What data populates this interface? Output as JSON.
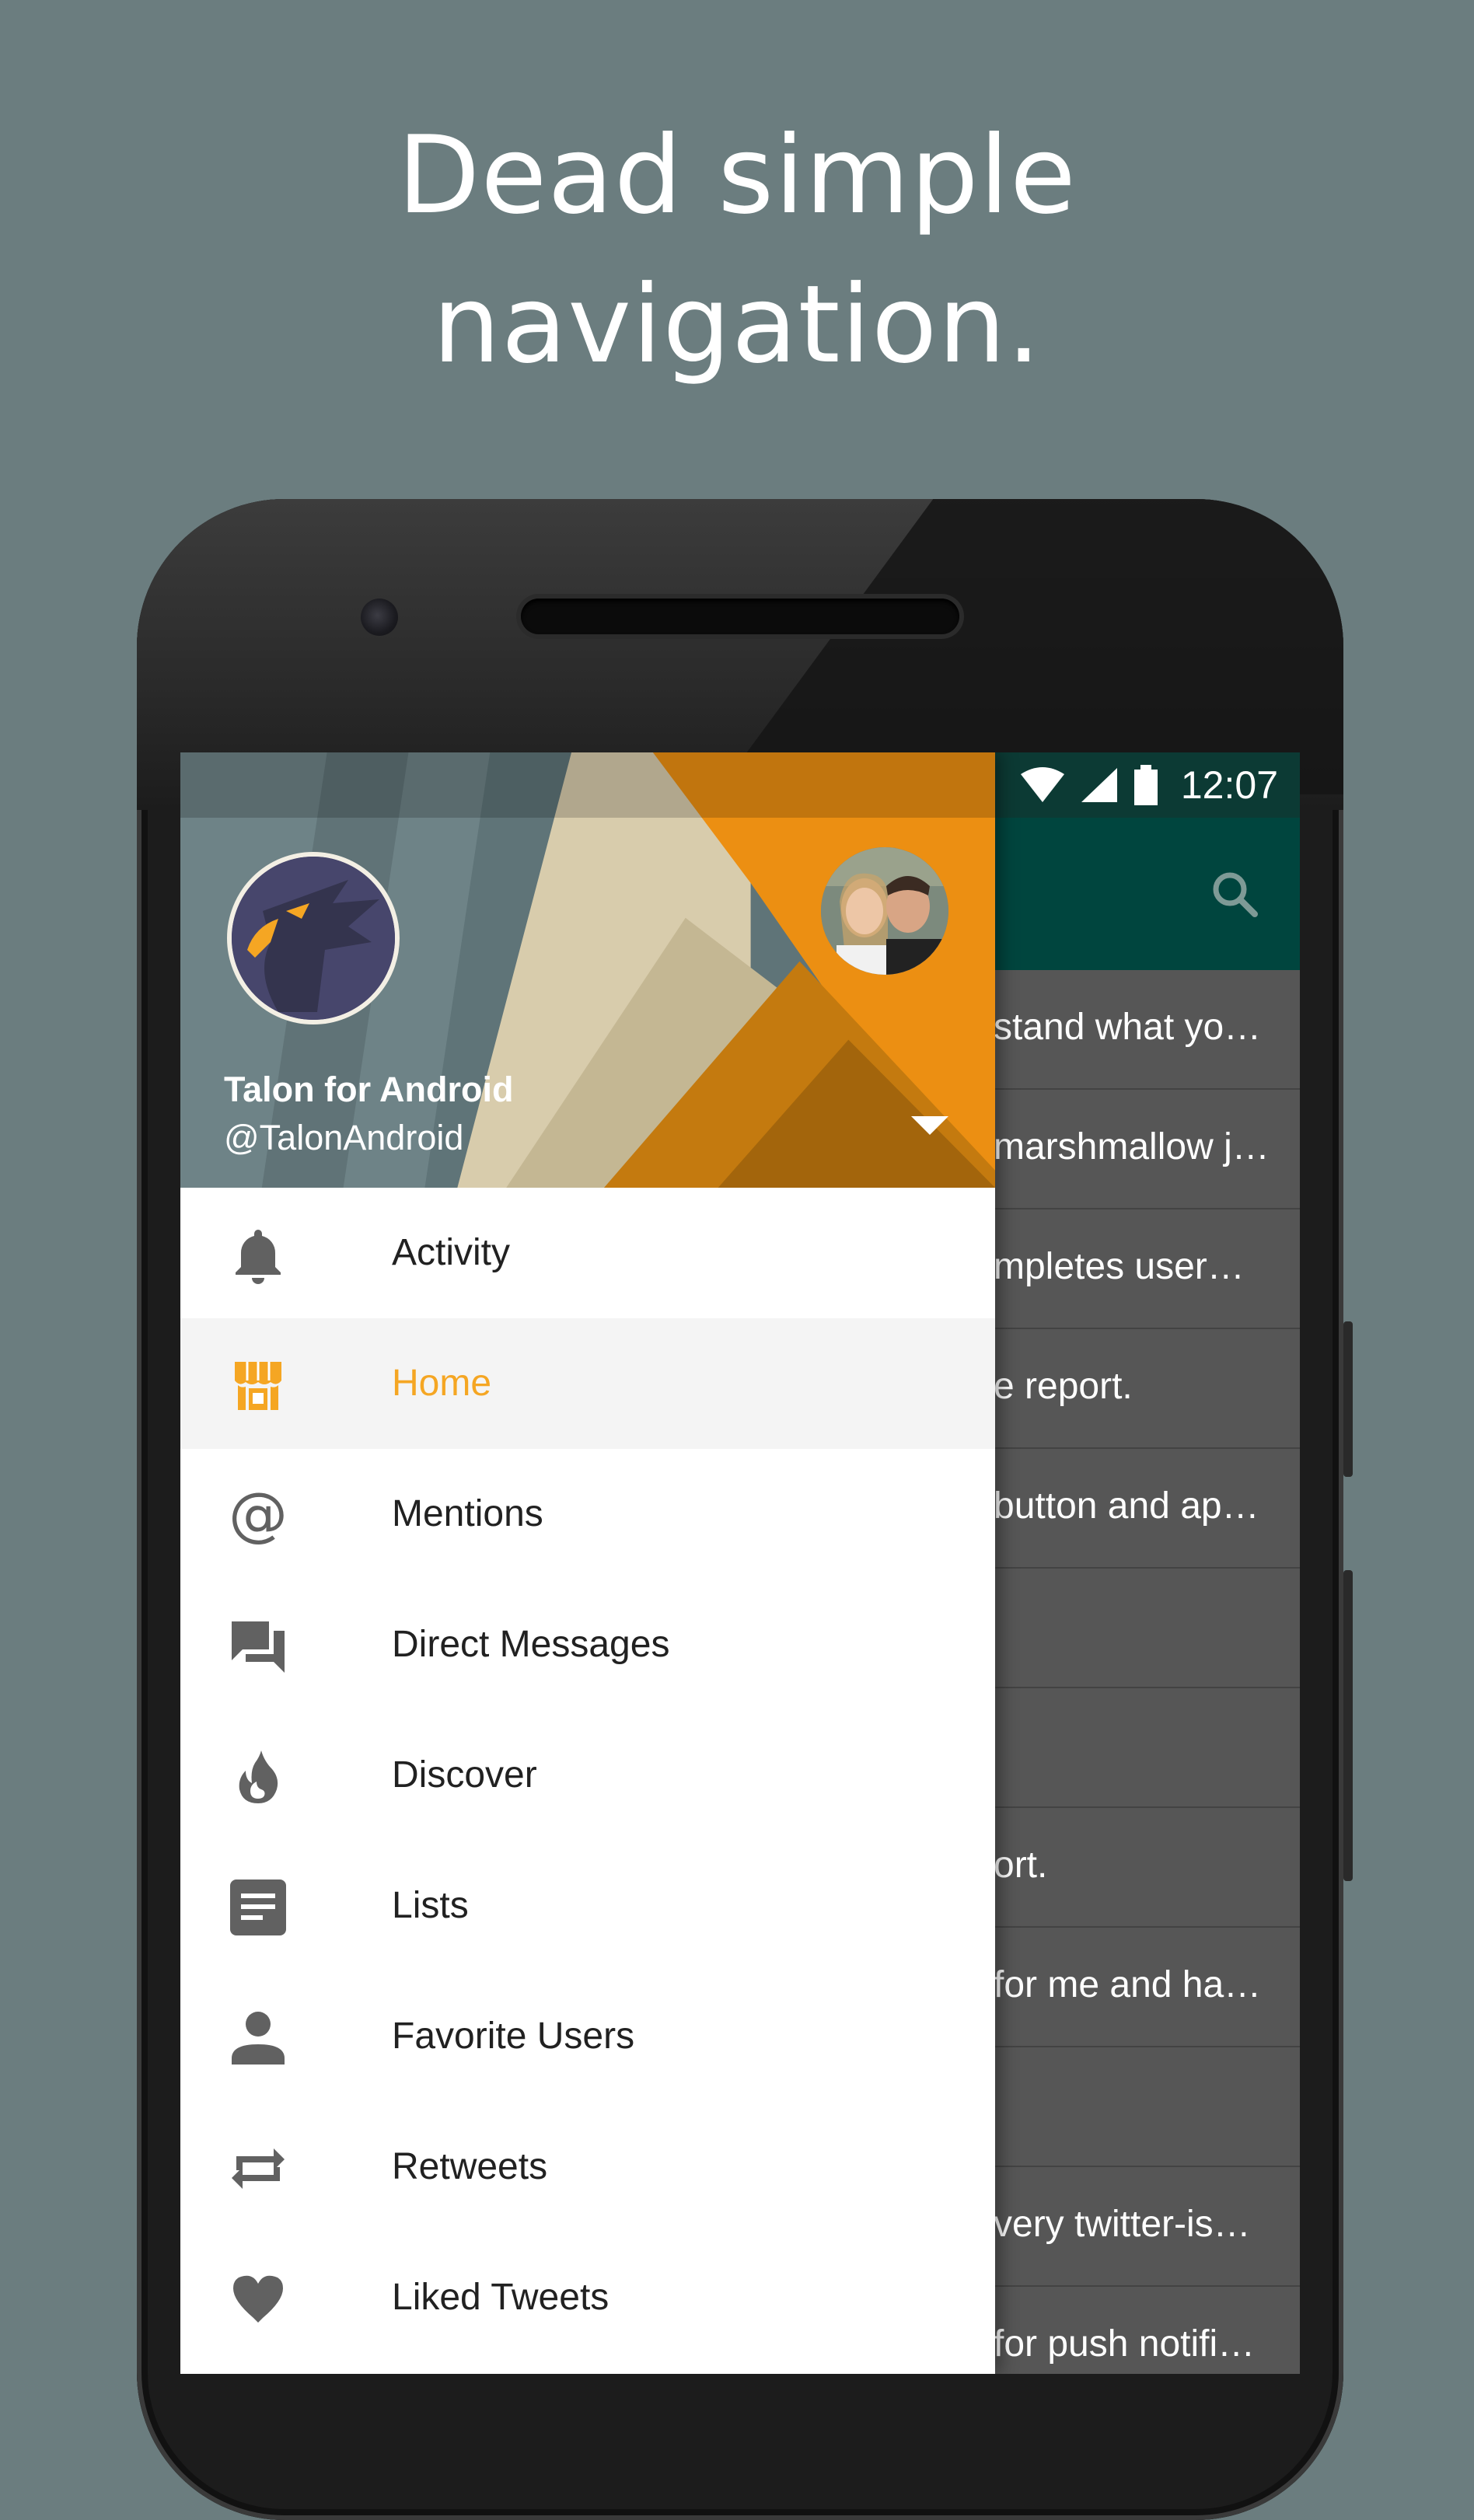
{
  "headline": {
    "line1": "Dead simple",
    "line2": "navigation."
  },
  "status_bar": {
    "time": "12:07"
  },
  "drawer": {
    "profile": {
      "name": "Talon for Android",
      "handle": "@TalonAndroid"
    },
    "items": [
      {
        "label": "Activity",
        "icon": "bell-icon"
      },
      {
        "label": "Home",
        "icon": "storefront-icon",
        "active": true
      },
      {
        "label": "Mentions",
        "icon": "at-icon"
      },
      {
        "label": "Direct Messages",
        "icon": "chat-bubbles-icon"
      },
      {
        "label": "Discover",
        "icon": "flame-icon"
      },
      {
        "label": "Lists",
        "icon": "list-icon"
      },
      {
        "label": "Favorite Users",
        "icon": "person-icon"
      },
      {
        "label": "Retweets",
        "icon": "retweet-icon"
      },
      {
        "label": "Liked Tweets",
        "icon": "heart-icon"
      }
    ]
  },
  "feed": {
    "rows": [
      "stand what yo…",
      "marshmallow j…",
      "mpletes user…",
      "e report.",
      "button and ap…",
      "",
      "",
      "ort.",
      "for me and ha…",
      "",
      "very twitter-is…",
      "for push notifi…"
    ]
  },
  "colors": {
    "background": "#6b7d7f",
    "accent": "#f5a623",
    "appbar": "#00453e",
    "statusbar": "#0c3a34"
  }
}
